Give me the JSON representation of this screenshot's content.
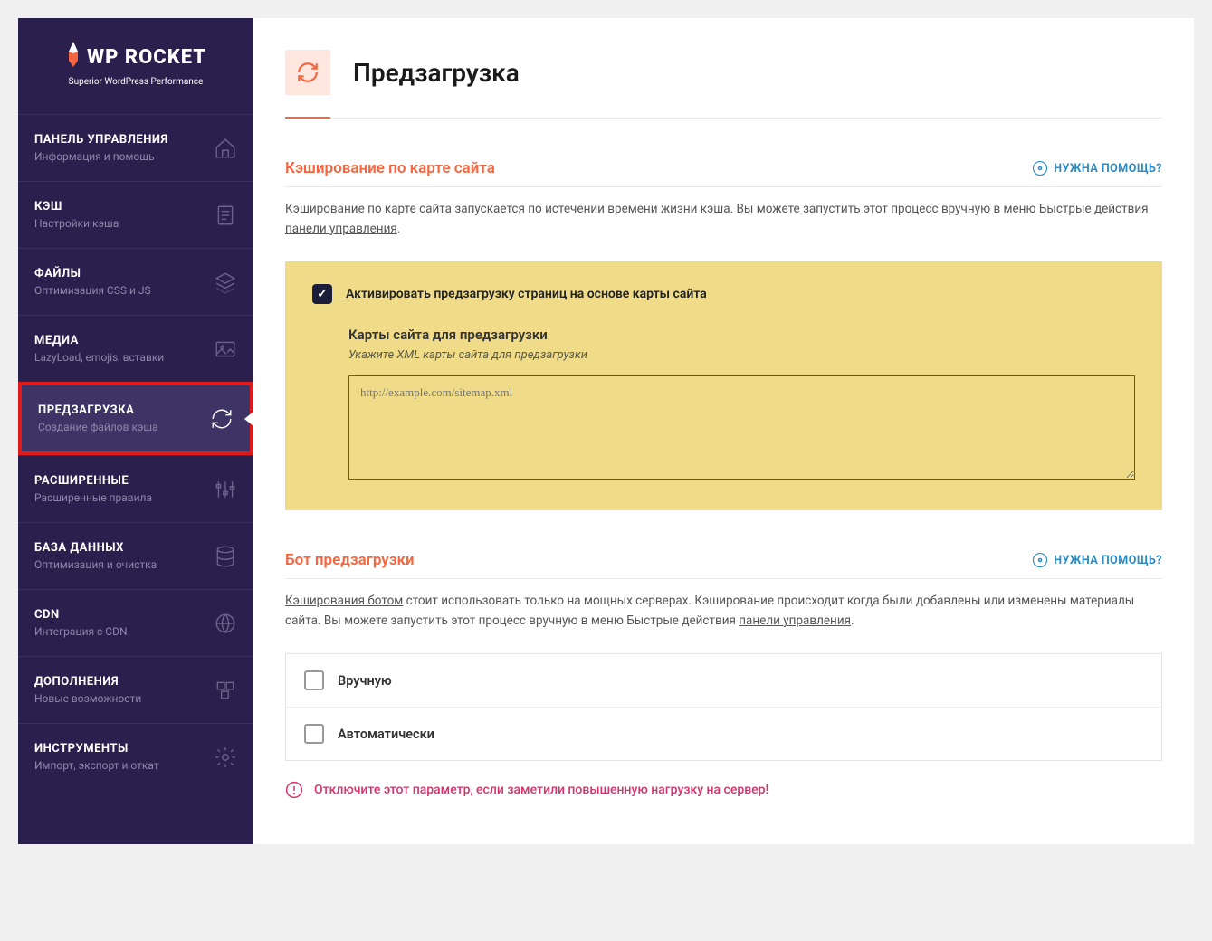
{
  "logo": {
    "brand": "WP ROCKET",
    "tagline": "Superior WordPress Performance"
  },
  "nav": [
    {
      "title": "ПАНЕЛЬ УПРАВЛЕНИЯ",
      "sub": "Информация и помощь",
      "icon": "home"
    },
    {
      "title": "КЭШ",
      "sub": "Настройки кэша",
      "icon": "file"
    },
    {
      "title": "ФАЙЛЫ",
      "sub": "Оптимизация CSS и JS",
      "icon": "layers"
    },
    {
      "title": "МЕДИА",
      "sub": "LazyLoad, emojis, вставки",
      "icon": "image"
    },
    {
      "title": "ПРЕДЗАГРУЗКА",
      "sub": "Создание файлов кэша",
      "icon": "refresh",
      "active": true
    },
    {
      "title": "РАСШИРЕННЫЕ",
      "sub": "Расширенные правила",
      "icon": "sliders"
    },
    {
      "title": "БАЗА ДАННЫХ",
      "sub": "Оптимизация и очистка",
      "icon": "database"
    },
    {
      "title": "CDN",
      "sub": "Интеграция с CDN",
      "icon": "globe"
    },
    {
      "title": "ДОПОЛНЕНИЯ",
      "sub": "Новые возможности",
      "icon": "boxes"
    },
    {
      "title": "ИНСТРУМЕНТЫ",
      "sub": "Импорт, экспорт и откат",
      "icon": "gear"
    }
  ],
  "page": {
    "title": "Предзагрузка"
  },
  "help_label": "НУЖНА ПОМОЩЬ?",
  "section_sitemap": {
    "title": "Кэширование по карте сайта",
    "desc_pre": "Кэширование по карте сайта запускается по истечении времени жизни кэша. Вы можете запустить этот процесс вручную в меню Быстрые действия ",
    "desc_link": "панели управления",
    "desc_post": ".",
    "checkbox_label": "Активировать предзагрузку страниц на основе карты сайта",
    "checkbox_checked": true,
    "sub_title": "Карты сайта для предзагрузки",
    "sub_desc": "Укажите XML карты сайта для предзагрузки",
    "textarea_placeholder": "http://example.com/sitemap.xml",
    "textarea_value": ""
  },
  "section_bot": {
    "title": "Бот предзагрузки",
    "desc_link1": "Кэширования ботом",
    "desc_mid": " стоит использовать только на мощных серверах. Кэширование происходит когда были добавлены или изменены материалы сайта. Вы можете запустить этот процесс вручную в меню Быстрые действия ",
    "desc_link2": "панели управления",
    "desc_post": ".",
    "options": [
      {
        "label": "Вручную",
        "checked": false
      },
      {
        "label": "Автоматически",
        "checked": false
      }
    ],
    "warning": "Отключите этот параметр, если заметили повышенную нагрузку на сервер!"
  }
}
